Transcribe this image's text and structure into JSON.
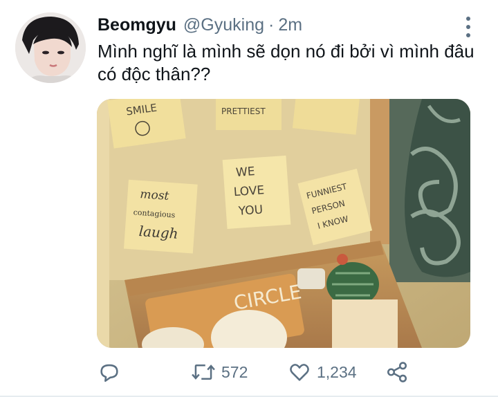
{
  "tweet": {
    "author_name": "Beomgyu",
    "author_handle": "@Gyuking",
    "separator": "·",
    "time": "2m",
    "text": "Mình nghĩ là mình sẽ dọn nó đi bởi vì mình đâu có độc thân??"
  },
  "media": {
    "notes": {
      "top_left": "SMILE",
      "top_middle": "PRETTIEST",
      "center": [
        "WE",
        "LOVE",
        "YOU"
      ],
      "left": [
        "most",
        "contagious",
        "laugh"
      ],
      "right": [
        "FUNNIEST",
        "PERSON",
        "I KNOW"
      ]
    },
    "box_label": "CIRCLE"
  },
  "actions": {
    "retweet_count": "572",
    "like_count": "1,234"
  },
  "icons": {
    "reply": "reply-icon",
    "retweet": "retweet-icon",
    "like": "heart-icon",
    "share": "share-icon",
    "more": "more-vertical-icon"
  },
  "colors": {
    "text": "#0f1419",
    "secondary": "#5b7083",
    "photo_tone": "#c9b78a"
  }
}
